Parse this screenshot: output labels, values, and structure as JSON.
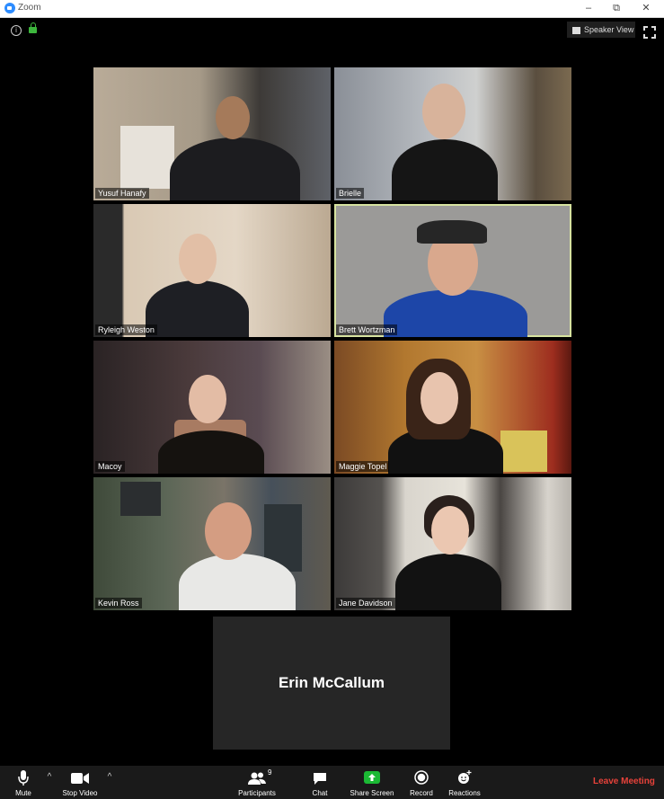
{
  "window": {
    "title": "Zoom",
    "controls": [
      "–",
      "⧉",
      "✕"
    ]
  },
  "header": {
    "speaker_view_label": "Speaker View"
  },
  "participants": [
    {
      "name": "Yusuf Hanafy",
      "active": false
    },
    {
      "name": "Brielle",
      "active": false
    },
    {
      "name": "Ryleigh Weston",
      "active": false
    },
    {
      "name": "Brett Wortzman",
      "active": true
    },
    {
      "name": "Macoy",
      "active": false
    },
    {
      "name": "Maggie Topel",
      "active": false
    },
    {
      "name": "Kevin Ross",
      "active": false
    },
    {
      "name": "Jane Davidson",
      "active": false
    }
  ],
  "video_off_tile": {
    "name": "Erin McCallum"
  },
  "toolbar": {
    "mute_label": "Mute",
    "stop_video_label": "Stop Video",
    "participants_label": "Participants",
    "participants_count": "9",
    "chat_label": "Chat",
    "share_screen_label": "Share Screen",
    "record_label": "Record",
    "reactions_label": "Reactions",
    "leave_label": "Leave Meeting",
    "caret": "^"
  },
  "colors": {
    "share_green": "#1bb934",
    "leave_red": "#e8423a",
    "active_speaker": "#d7e3a0",
    "secure_green": "#3db73d"
  }
}
